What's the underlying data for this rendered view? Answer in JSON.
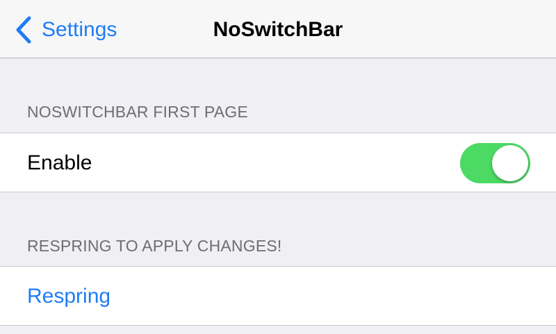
{
  "nav": {
    "back_label": "Settings",
    "title": "NoSwitchBar"
  },
  "sections": [
    {
      "header": "NOSWITCHBAR FIRST PAGE",
      "cell_label": "Enable",
      "toggle_on": true
    },
    {
      "header": "RESPRING TO APPLY CHANGES!",
      "cell_label": "Respring"
    }
  ],
  "colors": {
    "accent": "#1f7cf6",
    "toggle_on": "#4cd964",
    "background": "#efeff4",
    "header_text": "#6d6d72"
  }
}
